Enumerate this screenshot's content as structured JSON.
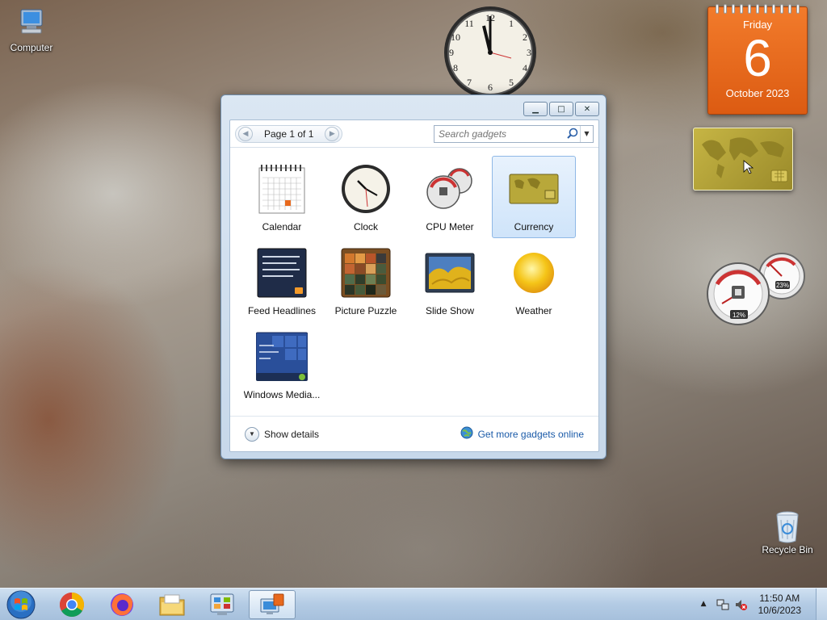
{
  "desktop": {
    "icons": [
      {
        "label": "Computer",
        "icon": "computer-icon"
      },
      {
        "label": "Recycle Bin",
        "icon": "recycle-bin-icon"
      }
    ]
  },
  "gadgets_on_desktop": {
    "calendar": {
      "weekday": "Friday",
      "day": "6",
      "month_year": "October 2023"
    },
    "clock": {
      "time_shown": "11:50"
    },
    "cpu_meter": {
      "cpu": "12%",
      "memory": "23%"
    },
    "currency": {
      "icon": "world-map-card-icon"
    }
  },
  "gallery": {
    "pager": {
      "label": "Page 1 of 1",
      "prev_icon": "arrow-left-icon",
      "next_icon": "arrow-right-icon"
    },
    "search": {
      "placeholder": "Search gadgets"
    },
    "items": [
      {
        "label": "Calendar",
        "icon": "calendar-icon",
        "selected": false
      },
      {
        "label": "Clock",
        "icon": "clock-icon",
        "selected": false
      },
      {
        "label": "CPU Meter",
        "icon": "cpu-meter-icon",
        "selected": false
      },
      {
        "label": "Currency",
        "icon": "currency-icon",
        "selected": true
      },
      {
        "label": "Feed Headlines",
        "icon": "feed-headlines-icon",
        "selected": false
      },
      {
        "label": "Picture Puzzle",
        "icon": "picture-puzzle-icon",
        "selected": false
      },
      {
        "label": "Slide Show",
        "icon": "slide-show-icon",
        "selected": false
      },
      {
        "label": "Weather",
        "icon": "weather-icon",
        "selected": false
      },
      {
        "label": "Windows Media...",
        "icon": "windows-media-icon",
        "selected": false
      }
    ],
    "footer": {
      "details_label": "Show details",
      "more_label": "Get more gadgets online"
    },
    "window_buttons": [
      "minimize",
      "restore",
      "close"
    ]
  },
  "taskbar": {
    "apps": [
      "start-orb",
      "chrome",
      "firefox",
      "file-explorer",
      "control-panel",
      "gadgets"
    ],
    "active_app": "gadgets",
    "time": "11:50 AM",
    "date": "10/6/2023"
  },
  "colors": {
    "calendar_orange": "#e8691d",
    "selection_blue": "#cfe4fa",
    "link_blue": "#1a5aa8",
    "taskbar": "#b3cbe4"
  }
}
